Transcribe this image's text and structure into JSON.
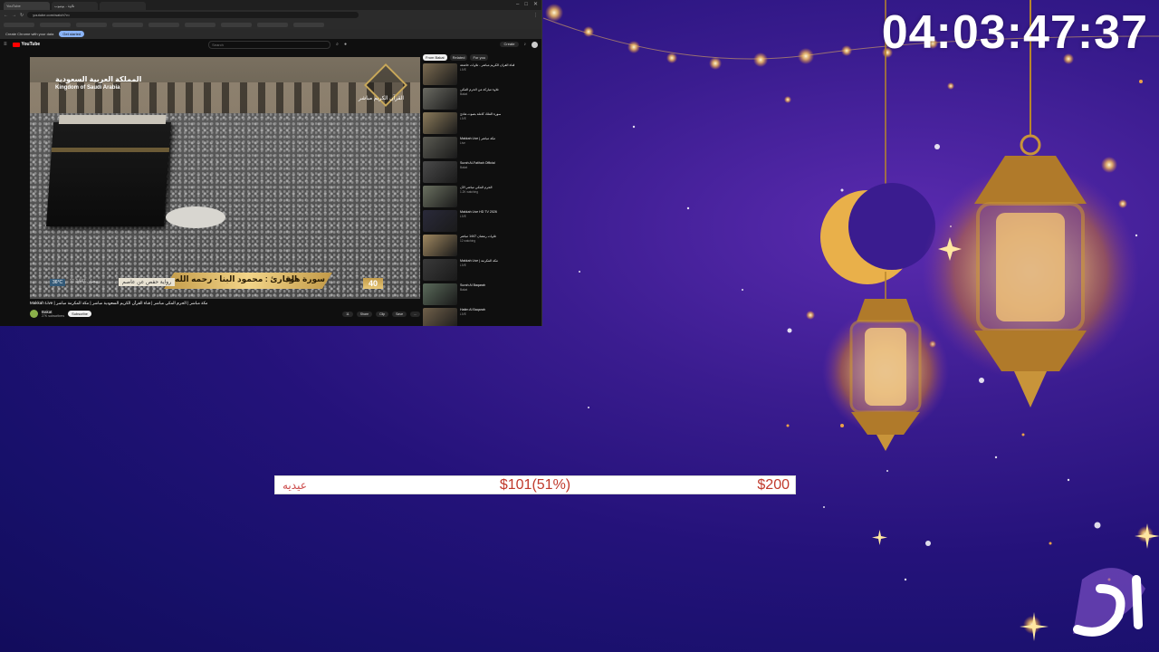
{
  "timer": "04:03:47:37",
  "donation": {
    "name": "عيديه",
    "current": "$101(51%)",
    "goal": "$200",
    "progress": 0.51
  },
  "browser": {
    "tabs": [
      "YouTube",
      "تلاوة - يوتيوب",
      ""
    ],
    "address": "youtube.com/watch?v=",
    "info_bar": [
      "Create Chrome with your data",
      "Get started"
    ],
    "search_placeholder": "Search",
    "create_label": "Create"
  },
  "player": {
    "title_ar": "المملكة العربية السعودية",
    "title_en": "Kingdom of Saudi Arabia",
    "logo_text": "القرآن الكريم مباشر",
    "reciter": "القارئ : محمود البنا - رحمه الله",
    "surah": "سورة هود",
    "riwaya": "رواية حفص عن عاصم",
    "temperature": "36°C",
    "date": "11 رمضان 1447",
    "time_badge": "40"
  },
  "video": {
    "title": "Makkah Live | مكة مباشر | الحرم المكي مباشر | قناة القرآن الكريم السعودية مباشر | مكة المكرمة مباشر",
    "channel": "Bakat",
    "subscribers": "27K subscribers",
    "subscribe": "Subscribe",
    "actions": [
      "11",
      "Share",
      "Clip",
      "Save",
      "..."
    ]
  },
  "sidebar": {
    "chips": [
      "From Bakat",
      "Related",
      "For you"
    ],
    "items": [
      {
        "title": "قناة القرآن الكريم مباشر - تلاوات خاشعة",
        "meta": "LIVE"
      },
      {
        "title": "تلاوة مباركة من الحرم المكي",
        "meta": "Bakat"
      },
      {
        "title": "سورة الملك كاملة بصوت هادئ",
        "meta": "LIVE"
      },
      {
        "title": "Makkah Live | مكة مباشر",
        "meta": "Live"
      },
      {
        "title": "Surah Al-Fatihah Official",
        "meta": "Bakat"
      },
      {
        "title": "الحرم المكي مباشر الآن",
        "meta": "1.2K watching"
      },
      {
        "title": "Makkah Live HD TV 2026",
        "meta": "LIVE"
      },
      {
        "title": "تلاوات رمضان 1447 مباشر",
        "meta": "12 watching"
      },
      {
        "title": "Makkah Live | مكة المكرمة",
        "meta": "LIVE"
      },
      {
        "title": "Surah Al Baqarah",
        "meta": "Bakat"
      },
      {
        "title": "Hatim Al Baqarah",
        "meta": "LIVE"
      }
    ]
  },
  "colors": {
    "background": "#24127a",
    "donation_text": "#c0392b",
    "gold": "#f2c46b"
  },
  "icons": [
    "moon-crescent-icon",
    "lantern-icon",
    "youtube-logo-icon",
    "search-icon",
    "mic-icon",
    "bell-icon"
  ]
}
